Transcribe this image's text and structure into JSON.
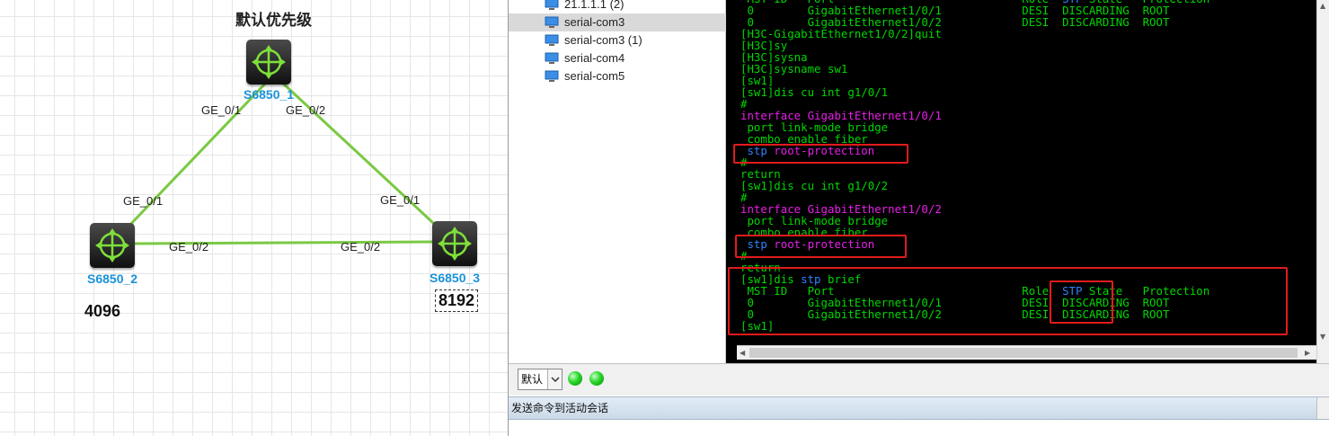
{
  "topology": {
    "title": "默认优先级",
    "devices": [
      {
        "name": "S6850_1"
      },
      {
        "name": "S6850_2",
        "priority": "4096"
      },
      {
        "name": "S6850_3",
        "priority": "8192"
      }
    ],
    "ports": {
      "s1_p1": "GE_0/1",
      "s1_p2": "GE_0/2",
      "s2_p1": "GE_0/1",
      "s2_p2": "GE_0/2",
      "s3_p1": "GE_0/1",
      "s3_p2": "GE_0/2"
    },
    "link_color": "#7ac943",
    "device_label_color": "#1a93d8"
  },
  "sessions": [
    {
      "label": "21.1.1.1 (2)"
    },
    {
      "label": "serial-com3"
    },
    {
      "label": "serial-com3 (1)"
    },
    {
      "label": "serial-com4"
    },
    {
      "label": "serial-com5"
    }
  ],
  "terminal": {
    "lines": [
      [
        {
          "t": " MST ID   Port                            Role  ",
          "c": "g"
        },
        {
          "t": "STP",
          "c": "b"
        },
        {
          "t": " State   Protection",
          "c": "g"
        }
      ],
      [
        {
          "t": " 0        GigabitEthernet1/0/1            DESI  DISCARDING  ROOT",
          "c": "g"
        }
      ],
      [
        {
          "t": " 0        GigabitEthernet1/0/2            DESI  DISCARDING  ROOT",
          "c": "g"
        }
      ],
      [
        {
          "t": "[H3C-GigabitEthernet1/0/2]quit",
          "c": "g"
        }
      ],
      [
        {
          "t": "[H3C]sy",
          "c": "g"
        }
      ],
      [
        {
          "t": "[H3C]sysna",
          "c": "g"
        }
      ],
      [
        {
          "t": "[H3C]sysname sw1",
          "c": "g"
        }
      ],
      [
        {
          "t": "[sw1]",
          "c": "g"
        }
      ],
      [
        {
          "t": "[sw1]dis cu int g1/0/1",
          "c": "g"
        }
      ],
      [
        {
          "t": "#",
          "c": "g"
        }
      ],
      [
        {
          "t": "interface",
          "c": "m"
        },
        {
          "t": " GigabitEthernet1/0/1",
          "c": "m"
        }
      ],
      [
        {
          "t": " port link-mode bridge",
          "c": "g"
        }
      ],
      [
        {
          "t": " combo enable fiber",
          "c": "g"
        }
      ],
      [
        {
          "t": " stp",
          "c": "b"
        },
        {
          "t": " root-protection",
          "c": "m"
        }
      ],
      [
        {
          "t": "#",
          "c": "g"
        }
      ],
      [
        {
          "t": "return",
          "c": "g"
        }
      ],
      [
        {
          "t": "[sw1]dis cu int g1/0/2",
          "c": "g"
        }
      ],
      [
        {
          "t": "#",
          "c": "g"
        }
      ],
      [
        {
          "t": "interface",
          "c": "m"
        },
        {
          "t": " GigabitEthernet1/0/2",
          "c": "m"
        }
      ],
      [
        {
          "t": " port link-mode bridge",
          "c": "g"
        }
      ],
      [
        {
          "t": " combo enable fiber",
          "c": "g"
        }
      ],
      [
        {
          "t": " stp",
          "c": "b"
        },
        {
          "t": " root-protection",
          "c": "m"
        }
      ],
      [
        {
          "t": "#",
          "c": "g"
        }
      ],
      [
        {
          "t": "return",
          "c": "g"
        }
      ],
      [
        {
          "t": "[sw1]dis ",
          "c": "g"
        },
        {
          "t": "stp",
          "c": "b"
        },
        {
          "t": " brief",
          "c": "g"
        }
      ],
      [
        {
          "t": " MST ID   Port                            Role  ",
          "c": "g"
        },
        {
          "t": "STP",
          "c": "b"
        },
        {
          "t": " State   Protection",
          "c": "g"
        }
      ],
      [
        {
          "t": " 0        GigabitEthernet1/0/1            DESI  DISCARDING  ROOT",
          "c": "g"
        }
      ],
      [
        {
          "t": " 0        GigabitEthernet1/0/2            DESI  DISCARDING  ROOT",
          "c": "g"
        }
      ],
      [
        {
          "t": "[sw1]",
          "c": "g"
        }
      ]
    ],
    "colors": {
      "green": "#00d600",
      "magenta": "#e81ee8",
      "blue": "#2e82ff",
      "highlight": "#e21b1b"
    }
  },
  "toolbar": {
    "mode": "默认"
  },
  "sendbar": {
    "label": "发送命令到活动会话"
  }
}
